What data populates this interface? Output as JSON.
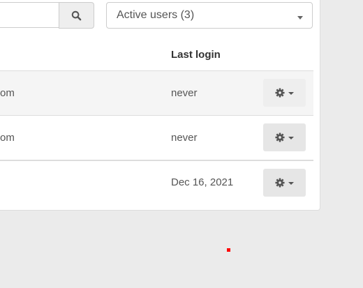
{
  "search": {
    "value": "",
    "button_icon": "search-icon"
  },
  "filter": {
    "selected": "Active users (3)"
  },
  "table": {
    "columns": {
      "last_login": "Last login"
    },
    "rows": [
      {
        "email_partial": "om",
        "last_login": "never",
        "action_icon": "gear-icon"
      },
      {
        "email_partial": "om",
        "last_login": "never",
        "action_icon": "gear-icon"
      },
      {
        "email_partial": "",
        "last_login": "Dec 16, 2021",
        "action_icon": "gear-icon"
      }
    ]
  },
  "colors": {
    "background": "#ebebeb",
    "panel": "#ffffff",
    "border": "#dddddd",
    "button_gray": "#e6e6e6",
    "marker": "#ff0000"
  }
}
